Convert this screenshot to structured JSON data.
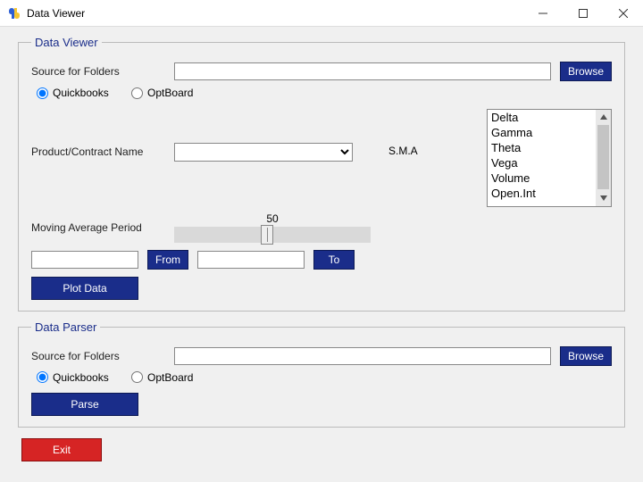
{
  "window": {
    "title": "Data Viewer"
  },
  "viewer": {
    "legend": "Data Viewer",
    "source_label": "Source for Folders",
    "source_value": "",
    "browse": "Browse",
    "radio_qb": "Quickbooks",
    "radio_ob": "OptBoard",
    "product_label": "Product/Contract Name",
    "product_value": "",
    "sma_label": "S.M.A",
    "sma_items": [
      "Delta",
      "Gamma",
      "Theta",
      "Vega",
      "Volume",
      "Open.Int"
    ],
    "mavg_label": "Moving Average Period",
    "mavg_value": "50",
    "from_value": "",
    "from_btn": "From",
    "to_value": "",
    "to_btn": "To",
    "plot_btn": "Plot Data"
  },
  "parser": {
    "legend": "Data Parser",
    "source_label": "Source for Folders",
    "source_value": "",
    "browse": "Browse",
    "radio_qb": "Quickbooks",
    "radio_ob": "OptBoard",
    "parse_btn": "Parse"
  },
  "footer": {
    "exit": "Exit"
  }
}
